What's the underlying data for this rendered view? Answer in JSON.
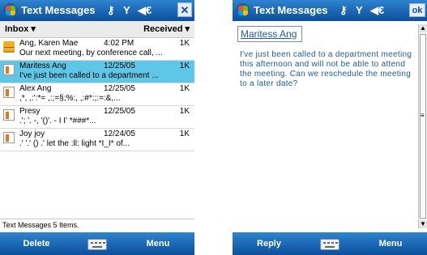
{
  "inbox_screen": {
    "title": "Text Messages",
    "status_icons": [
      "⚷",
      "Y",
      "◀€"
    ],
    "close_label": "✕",
    "header": {
      "folder": "Inbox ▾",
      "sort": "Received ▾"
    },
    "messages": [
      {
        "sender": "Ang, Karen Mae",
        "date": "4:02 PM",
        "size": "1K",
        "preview": "Our next meeting, by conference call, ...",
        "icon": "envelope-open-icon",
        "selected": false
      },
      {
        "sender": "Maritess Ang",
        "date": "12/25/05",
        "size": "1K",
        "preview": "I've just been called to a department ...",
        "icon": "document-icon",
        "selected": true
      },
      {
        "sender": "Alex Ang",
        "date": "12/25/05",
        "size": "1K",
        "preview": "  ,*,     ,:':*=    ,:;=§;%:,  ,:#*:;:=:&,...",
        "icon": "document-icon",
        "selected": false
      },
      {
        "sender": "Presy",
        "date": "12/25/05",
        "size": "1K",
        "preview": "  .'; '.      -, '()'. -        I I'       *###*...",
        "icon": "document-icon",
        "selected": false
      },
      {
        "sender": "Joy joy",
        "date": "12/24/05",
        "size": "1K",
        "preview": "  .' '.' () .'  let the  :ll:   light *I_I* of...",
        "icon": "document-icon",
        "selected": false
      }
    ],
    "status_text": "Text Messages  5 Items.",
    "softkeys": {
      "left": "Delete",
      "right": "Menu"
    }
  },
  "message_screen": {
    "title": "Text Messages",
    "status_icons": [
      "⚷",
      "Y",
      "◀€"
    ],
    "ok_label": "ok",
    "from": "Maritess Ang",
    "body": "I've just been called to a department meeting this afternoon and will not be able to attend the meeting. Can we reschedule the meeting to a later date?",
    "softkeys": {
      "left": "Reply",
      "right": "Menu"
    }
  }
}
